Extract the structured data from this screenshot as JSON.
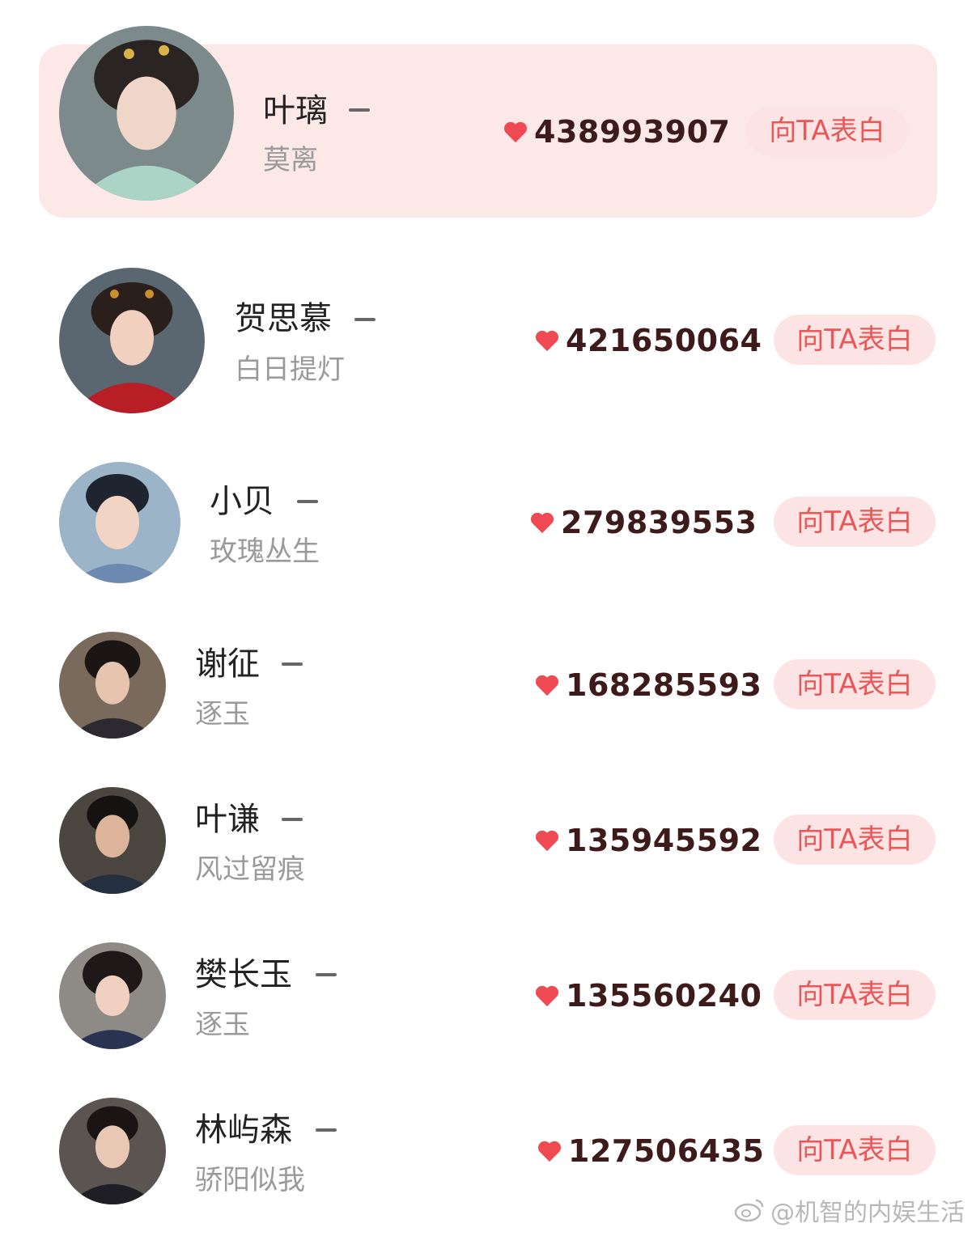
{
  "colors": {
    "top_card_bg": "#fde8e8",
    "button_bg": "#fce4e4",
    "button_text": "#e85858",
    "heart": "#ef4a52",
    "count_text": "#3d1b1b",
    "name_text": "#222222",
    "sub_text": "#9a9a9a"
  },
  "button_label": "向TA表白",
  "heart_icon": "heart-icon",
  "entries": [
    {
      "name": "叶璃",
      "drama": "莫离",
      "count": "438993907",
      "rank_change": "—"
    },
    {
      "name": "贺思慕",
      "drama": "白日提灯",
      "count": "421650064",
      "rank_change": "—"
    },
    {
      "name": "小贝",
      "drama": "玫瑰丛生",
      "count": "279839553",
      "rank_change": "—"
    },
    {
      "name": "谢征",
      "drama": "逐玉",
      "count": "168285593",
      "rank_change": "—"
    },
    {
      "name": "叶谦",
      "drama": "风过留痕",
      "count": "135945592",
      "rank_change": "—"
    },
    {
      "name": "樊长玉",
      "drama": "逐玉",
      "count": "135560240",
      "rank_change": "—"
    },
    {
      "name": "林屿森",
      "drama": "骄阳似我",
      "count": "127506435",
      "rank_change": "—"
    }
  ],
  "watermark": {
    "text": "@机智的内娱生活",
    "icon": "weibo-icon"
  }
}
